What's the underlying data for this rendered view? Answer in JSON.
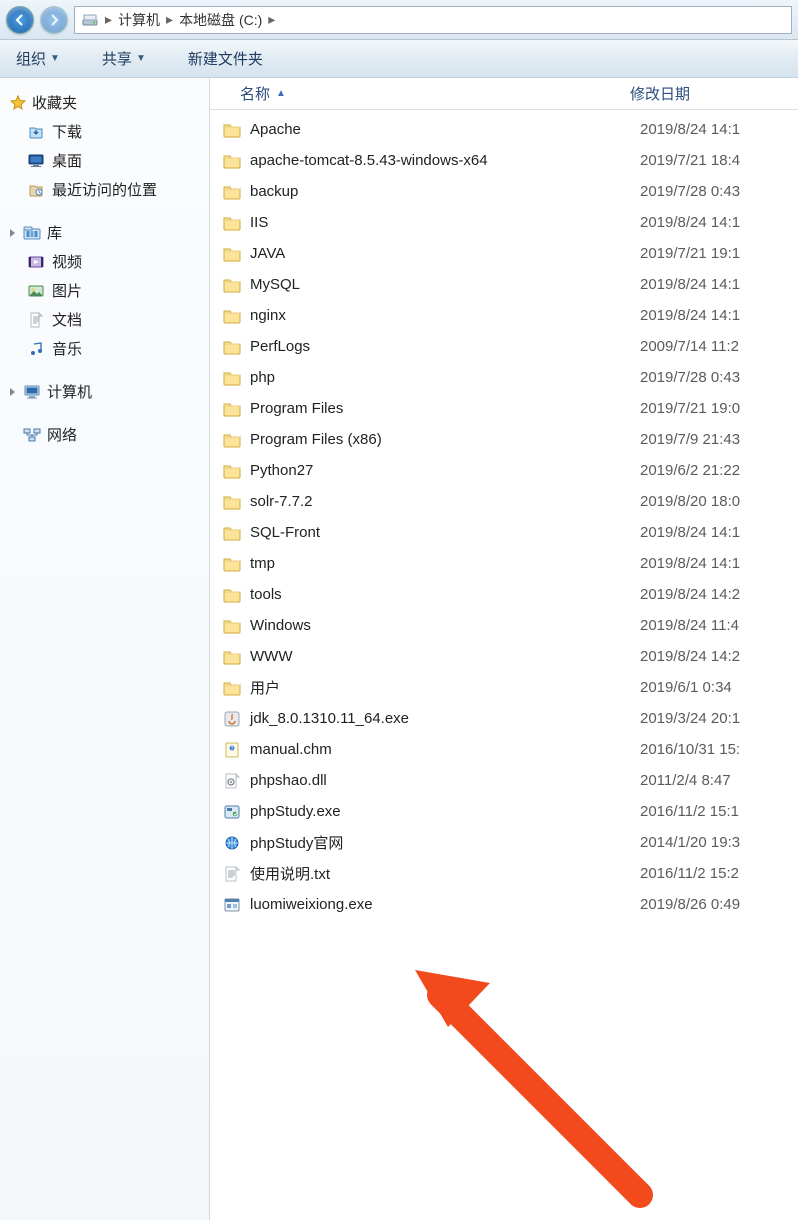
{
  "breadcrumb": {
    "root": "计算机",
    "drive": "本地磁盘 (C:)"
  },
  "toolbar": {
    "organize": "组织",
    "share": "共享",
    "newfolder": "新建文件夹"
  },
  "columns": {
    "name": "名称",
    "date": "修改日期"
  },
  "sidebar": {
    "favorites": {
      "label": "收藏夹",
      "items": [
        {
          "icon": "download",
          "label": "下载"
        },
        {
          "icon": "desktop",
          "label": "桌面"
        },
        {
          "icon": "recent",
          "label": "最近访问的位置"
        }
      ]
    },
    "libraries": {
      "label": "库",
      "items": [
        {
          "icon": "video",
          "label": "视频"
        },
        {
          "icon": "picture",
          "label": "图片"
        },
        {
          "icon": "document",
          "label": "文档"
        },
        {
          "icon": "music",
          "label": "音乐"
        }
      ]
    },
    "computer": {
      "label": "计算机"
    },
    "network": {
      "label": "网络"
    }
  },
  "files": [
    {
      "icon": "folder",
      "name": "Apache",
      "date": "2019/8/24 14:1"
    },
    {
      "icon": "folder",
      "name": "apache-tomcat-8.5.43-windows-x64",
      "date": "2019/7/21 18:4"
    },
    {
      "icon": "folder",
      "name": "backup",
      "date": "2019/7/28 0:43"
    },
    {
      "icon": "folder",
      "name": "IIS",
      "date": "2019/8/24 14:1"
    },
    {
      "icon": "folder",
      "name": "JAVA",
      "date": "2019/7/21 19:1"
    },
    {
      "icon": "folder",
      "name": "MySQL",
      "date": "2019/8/24 14:1"
    },
    {
      "icon": "folder",
      "name": "nginx",
      "date": "2019/8/24 14:1"
    },
    {
      "icon": "folder",
      "name": "PerfLogs",
      "date": "2009/7/14 11:2"
    },
    {
      "icon": "folder",
      "name": "php",
      "date": "2019/7/28 0:43"
    },
    {
      "icon": "folder",
      "name": "Program Files",
      "date": "2019/7/21 19:0"
    },
    {
      "icon": "folder",
      "name": "Program Files (x86)",
      "date": "2019/7/9 21:43"
    },
    {
      "icon": "folder",
      "name": "Python27",
      "date": "2019/6/2 21:22"
    },
    {
      "icon": "folder",
      "name": "solr-7.7.2",
      "date": "2019/8/20 18:0"
    },
    {
      "icon": "folder",
      "name": "SQL-Front",
      "date": "2019/8/24 14:1"
    },
    {
      "icon": "folder",
      "name": "tmp",
      "date": "2019/8/24 14:1"
    },
    {
      "icon": "folder",
      "name": "tools",
      "date": "2019/8/24 14:2"
    },
    {
      "icon": "folder",
      "name": "Windows",
      "date": "2019/8/24 11:4"
    },
    {
      "icon": "folder",
      "name": "WWW",
      "date": "2019/8/24 14:2"
    },
    {
      "icon": "folder",
      "name": "用户",
      "date": "2019/6/1 0:34"
    },
    {
      "icon": "java",
      "name": "jdk_8.0.1310.11_64.exe",
      "date": "2019/3/24 20:1"
    },
    {
      "icon": "chm",
      "name": "manual.chm",
      "date": "2016/10/31 15:"
    },
    {
      "icon": "dll",
      "name": "phpshao.dll",
      "date": "2011/2/4 8:47"
    },
    {
      "icon": "exe",
      "name": "phpStudy.exe",
      "date": "2016/11/2 15:1"
    },
    {
      "icon": "url",
      "name": "phpStudy官网",
      "date": "2014/1/20 19:3"
    },
    {
      "icon": "txt",
      "name": "使用说明.txt",
      "date": "2016/11/2 15:2"
    },
    {
      "icon": "app",
      "name": "luomiweixiong.exe",
      "date": "2019/8/26 0:49"
    }
  ]
}
